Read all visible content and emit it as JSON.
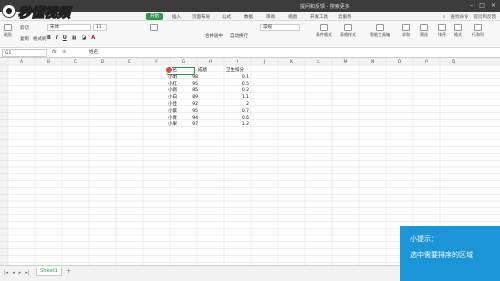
{
  "title": "提问和反馈 · 搜索更多",
  "logo_text": "秒懂视频",
  "menu": {
    "tabs": [
      "开始",
      "插入",
      "页面布局",
      "公式",
      "数据",
      "审阅",
      "视图",
      "开发工具",
      "云服务"
    ],
    "active_index": 0,
    "search_label": "查找命令",
    "account_label": "提问和反馈"
  },
  "toolbar": {
    "paste": "粘贴",
    "cut": "剪切",
    "copy": "复制",
    "format_painter": "格式刷",
    "font_name": "宋体",
    "font_size": "11",
    "merge_center": "合并居中",
    "wrap": "自动换行",
    "number_format": "常规",
    "conditional": "条件格式",
    "table_style": "表格样式",
    "smart_tools": "智能工具箱",
    "sum": "求和",
    "filter": "筛选",
    "sort": "排序",
    "format": "格式",
    "rows_cols": "行和列",
    "worksheet": "工作表"
  },
  "formula": {
    "name_box": "G1",
    "fx": "fx",
    "value": "姓名"
  },
  "columns": [
    "A",
    "B",
    "C",
    "D",
    "E",
    "F",
    "G",
    "H",
    "I",
    "J",
    "K",
    "L",
    "M",
    "N",
    "O",
    "P",
    "Q"
  ],
  "sheet": {
    "headers": [
      "姓名",
      "成绩",
      "卫生扣分"
    ],
    "rows": [
      {
        "name": "小明",
        "score": "98",
        "deduct": "0.1"
      },
      {
        "name": "小红",
        "score": "95",
        "deduct": "0.5"
      },
      {
        "name": "小刚",
        "score": "85",
        "deduct": "0.2"
      },
      {
        "name": "小白",
        "score": "89",
        "deduct": "1.1"
      },
      {
        "name": "小佳",
        "score": "92",
        "deduct": "2"
      },
      {
        "name": "小紫",
        "score": "95",
        "deduct": "0.7"
      },
      {
        "name": "小青",
        "score": "94",
        "deduct": "0.6"
      },
      {
        "name": "小果",
        "score": "97",
        "deduct": "1.2"
      }
    ]
  },
  "status": {
    "sheet_name": "Sheet1",
    "add_sheet": "+"
  },
  "tip": {
    "title": "小提示：",
    "body": "选中需要排序的区域"
  },
  "colors": {
    "accent": "#2b9a4f",
    "tip_bg": "#1a96d6"
  }
}
